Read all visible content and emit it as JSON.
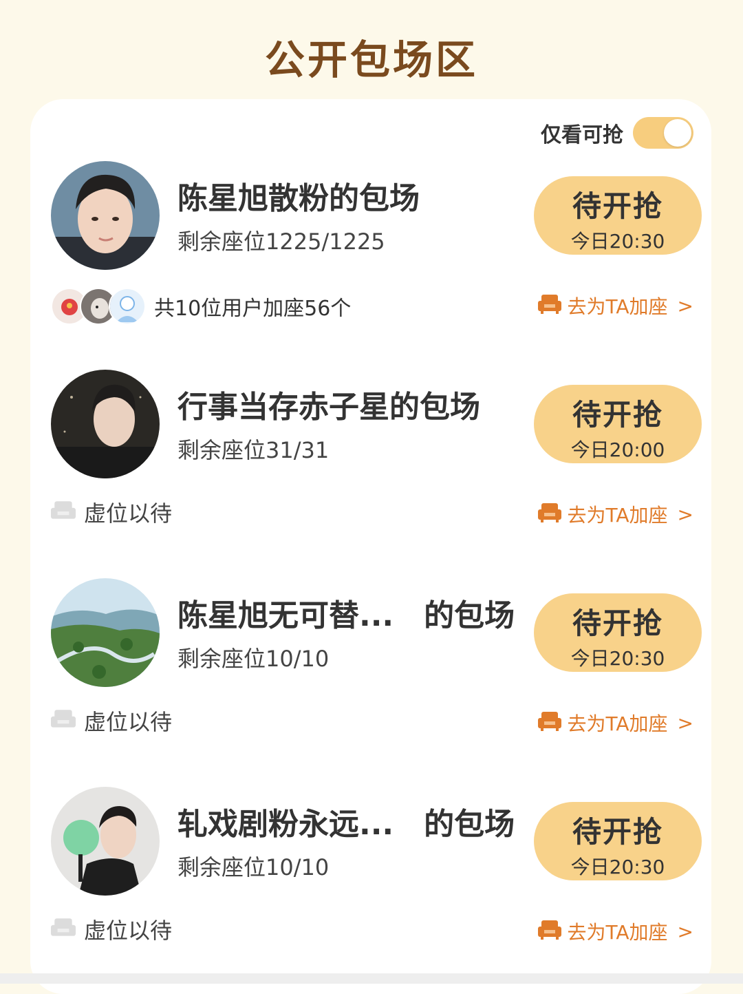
{
  "header": {
    "title": "公开包场区"
  },
  "filter": {
    "label": "仅看可抢",
    "enabled": true
  },
  "sessions": [
    {
      "title": "陈星旭散粉的包场",
      "seats": "剩余座位1225/1225",
      "button": {
        "label": "待开抢",
        "time": "今日20:30"
      },
      "footer": {
        "type": "users",
        "text": "共10位用户加座56个"
      },
      "action": "去为TA加座",
      "action_chevron": ">"
    },
    {
      "title": "行事当存赤子星的包场",
      "seats": "剩余座位31/31",
      "button": {
        "label": "待开抢",
        "time": "今日20:00"
      },
      "footer": {
        "type": "empty",
        "text": "虚位以待"
      },
      "action": "去为TA加座",
      "action_chevron": ">"
    },
    {
      "title": "陈星旭无可替...　的包场",
      "seats": "剩余座位10/10",
      "button": {
        "label": "待开抢",
        "time": "今日20:30"
      },
      "footer": {
        "type": "empty",
        "text": "虚位以待"
      },
      "action": "去为TA加座",
      "action_chevron": ">"
    },
    {
      "title": "轧戏剧粉永远...　的包场",
      "seats": "剩余座位10/10",
      "button": {
        "label": "待开抢",
        "time": "今日20:30"
      },
      "footer": {
        "type": "empty",
        "text": "虚位以待"
      },
      "action": "去为TA加座",
      "action_chevron": ">"
    }
  ],
  "colors": {
    "accent": "#f8d28a",
    "toggle": "#f7cd7e",
    "action": "#e07b2a",
    "title": "#7a4a1e",
    "background": "#fdf9ea"
  },
  "icons": {
    "seat_action": "sofa-icon",
    "seat_empty": "sofa-icon"
  }
}
